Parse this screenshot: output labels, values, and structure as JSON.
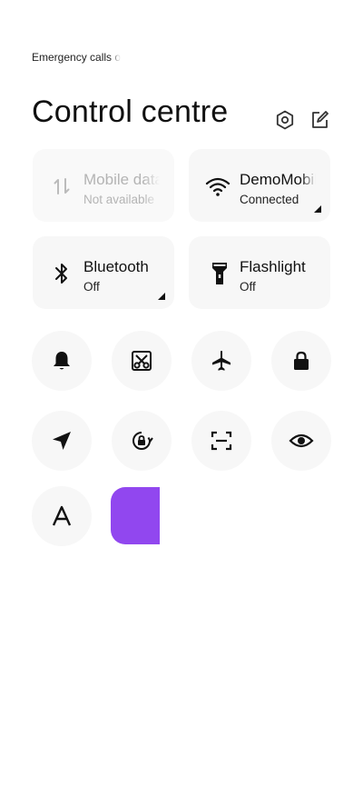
{
  "status_bar": {
    "text": "Emergency calls only"
  },
  "header": {
    "title": "Control centre"
  },
  "tiles": [
    {
      "label": "Mobile data",
      "sub": "Not available"
    },
    {
      "label": "DemoMobile",
      "sub": "Connected"
    },
    {
      "label": "Bluetooth",
      "sub": "Off"
    },
    {
      "label": "Flashlight",
      "sub": "Off"
    }
  ],
  "toggles": [
    {
      "icon": "bell-icon"
    },
    {
      "icon": "screenshot-scissors-icon"
    },
    {
      "icon": "airplane-icon"
    },
    {
      "icon": "lock-icon"
    },
    {
      "icon": "location-icon"
    },
    {
      "icon": "rotation-lock-icon"
    },
    {
      "icon": "scan-icon"
    },
    {
      "icon": "eye-icon"
    },
    {
      "icon": "font-a-icon"
    }
  ],
  "colors": {
    "accent": "#9147ef",
    "tile_bg": "#f7f7f7",
    "text": "#111111",
    "disabled_text": "#b4b4b4"
  }
}
